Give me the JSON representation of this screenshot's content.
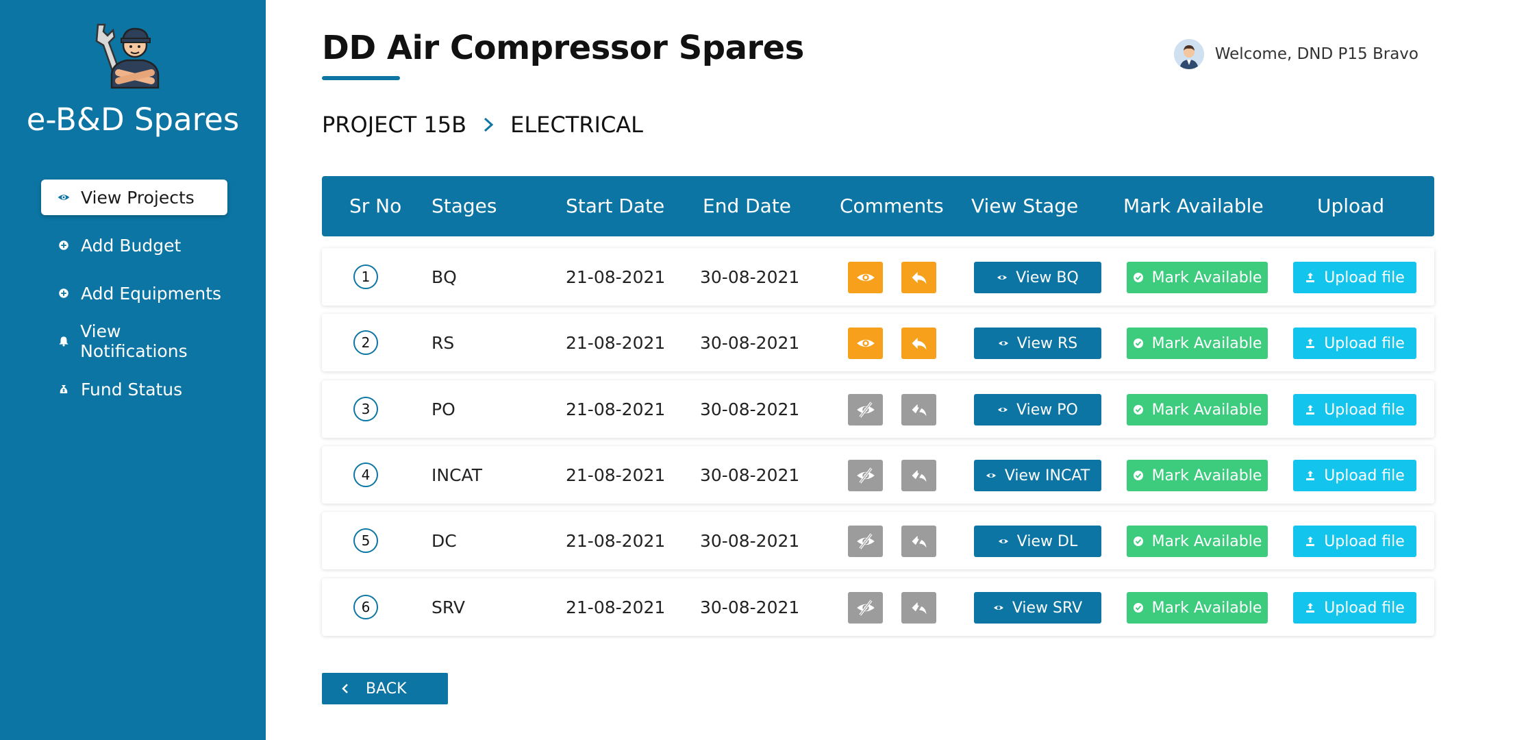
{
  "app": {
    "brand": "e-B&D Spares",
    "title": "DD Air Compressor Spares",
    "welcome": "Welcome, DND P15 Bravo"
  },
  "sidebar": {
    "items": [
      {
        "label": "View Projects",
        "icon": "eye-icon",
        "active": true
      },
      {
        "label": "Add Budget",
        "icon": "plus-circle-icon",
        "active": false
      },
      {
        "label": "Add Equipments",
        "icon": "plus-circle-icon",
        "active": false
      },
      {
        "label": "View Notifications",
        "icon": "bell-icon",
        "active": false
      },
      {
        "label": "Fund Status",
        "icon": "money-bag-icon",
        "active": false
      }
    ]
  },
  "breadcrumb": {
    "project": "PROJECT 15B",
    "section": "ELECTRICAL"
  },
  "table": {
    "headers": [
      "Sr No",
      "Stages",
      "Start Date",
      "End Date",
      "Comments",
      "View Stage",
      "Mark Available",
      "Upload"
    ],
    "rows": [
      {
        "sr": "1",
        "stage": "BQ",
        "start": "21-08-2021",
        "end": "30-08-2021",
        "comments_enabled": true,
        "view_label": "View BQ",
        "mark_label": "Mark Available",
        "upload_label": "Upload file"
      },
      {
        "sr": "2",
        "stage": "RS",
        "start": "21-08-2021",
        "end": "30-08-2021",
        "comments_enabled": true,
        "view_label": "View RS",
        "mark_label": "Mark Available",
        "upload_label": "Upload file"
      },
      {
        "sr": "3",
        "stage": "PO",
        "start": "21-08-2021",
        "end": "30-08-2021",
        "comments_enabled": false,
        "view_label": "View PO",
        "mark_label": "Mark Available",
        "upload_label": "Upload file"
      },
      {
        "sr": "4",
        "stage": "INCAT",
        "start": "21-08-2021",
        "end": "30-08-2021",
        "comments_enabled": false,
        "view_label": "View INCAT",
        "mark_label": "Mark Available",
        "upload_label": "Upload file"
      },
      {
        "sr": "5",
        "stage": "DC",
        "start": "21-08-2021",
        "end": "30-08-2021",
        "comments_enabled": false,
        "view_label": "View DL",
        "mark_label": "Mark Available",
        "upload_label": "Upload file"
      },
      {
        "sr": "6",
        "stage": "SRV",
        "start": "21-08-2021",
        "end": "30-08-2021",
        "comments_enabled": false,
        "view_label": "View SRV",
        "mark_label": "Mark Available",
        "upload_label": "Upload file"
      }
    ]
  },
  "back_label": "BACK",
  "colors": {
    "primary": "#0c75a3",
    "orange": "#f7a01b",
    "gray": "#9c9c9c",
    "green": "#3dcc7e",
    "cyan": "#13c4ec"
  }
}
